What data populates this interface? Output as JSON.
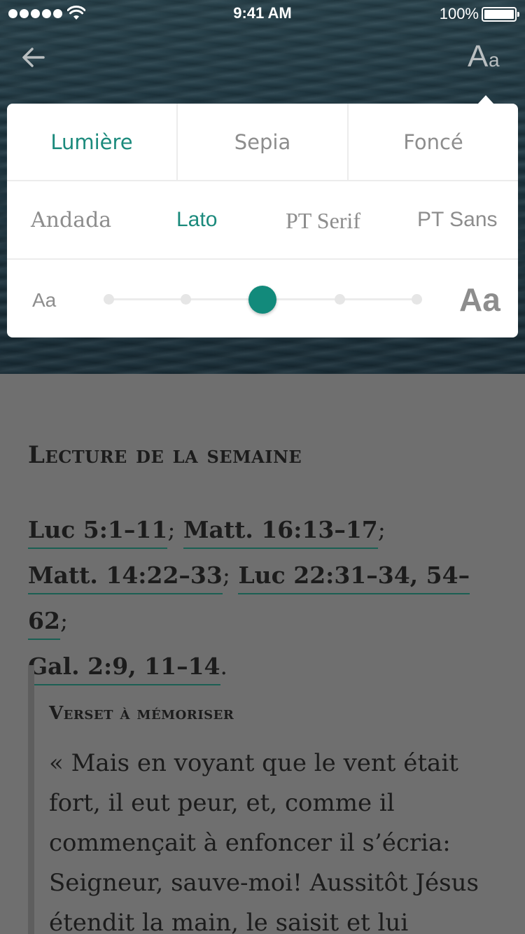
{
  "status_bar": {
    "time": "9:41 AM",
    "battery": "100%"
  },
  "header": {
    "back_icon": "arrow-left-icon",
    "text_settings_icon": "text-size-icon",
    "text_settings_big": "A",
    "text_settings_small": "a"
  },
  "settings": {
    "themes": [
      {
        "label": "Lumière",
        "active": true
      },
      {
        "label": "Sepia",
        "active": false
      },
      {
        "label": "Foncé",
        "active": false
      }
    ],
    "fonts": [
      {
        "label": "Andada",
        "active": false
      },
      {
        "label": "Lato",
        "active": true
      },
      {
        "label": "PT Serif",
        "active": false
      },
      {
        "label": "PT Sans",
        "active": false
      }
    ],
    "size": {
      "small_label": "Aa",
      "large_label": "Aa",
      "steps": 5,
      "selected_step": 3
    },
    "accent_color": "#128a7b"
  },
  "content": {
    "section_title": "Lecture de la semaine",
    "references": [
      "Luc 5:1–11",
      "Matt. 16:13–17",
      "Matt. 14:22–33",
      "Luc 22:31–34, 54–62",
      "Gal. 2:9, 11–14"
    ],
    "separators": [
      ";",
      ";",
      ";",
      ";",
      "."
    ],
    "memory_verse_title": "Verset à mémoriser",
    "memory_verse_text": "« Mais en voyant que le vent était fort, il eut peur, et, comme il commençait à enfoncer il s’écria: Seigneur, sauve-moi! Aussitôt Jésus étendit la main, le saisit et lui"
  }
}
